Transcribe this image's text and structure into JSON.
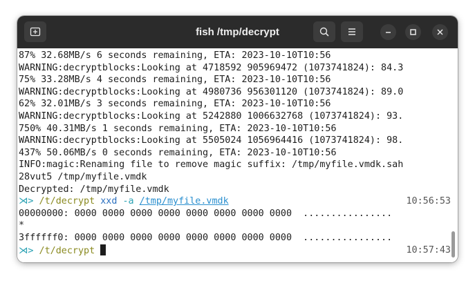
{
  "window": {
    "title": "fish /tmp/decrypt"
  },
  "titlebar": {
    "new_tab_icon": "new-tab-icon",
    "search_icon": "search-icon",
    "menu_icon": "hamburger-menu-icon",
    "minimize_icon": "minimize-icon",
    "maximize_icon": "maximize-icon",
    "close_icon": "close-icon"
  },
  "terminal": {
    "output": [
      "87% 32.68MB/s 6 seconds remaining, ETA: 2023-10-10T10:56",
      "WARNING:decryptblocks:Looking at 4718592 905969472 (1073741824): 84.3",
      "75% 33.28MB/s 4 seconds remaining, ETA: 2023-10-10T10:56",
      "WARNING:decryptblocks:Looking at 4980736 956301120 (1073741824): 89.0",
      "62% 32.01MB/s 3 seconds remaining, ETA: 2023-10-10T10:56",
      "WARNING:decryptblocks:Looking at 5242880 1006632768 (1073741824): 93.",
      "750% 40.31MB/s 1 seconds remaining, ETA: 2023-10-10T10:56",
      "WARNING:decryptblocks:Looking at 5505024 1056964416 (1073741824): 98.",
      "437% 50.06MB/s 0 seconds remaining, ETA: 2023-10-10T10:56",
      "INFO:magic:Renaming file to remove magic suffix: /tmp/myfile.vmdk.sah",
      "28vut5 /tmp/myfile.vmdk",
      "Decrypted: /tmp/myfile.vmdk"
    ],
    "prompt1": {
      "arrow": "⋊>",
      "dir": "/t/decrypt",
      "command": "xxd",
      "flag": "-a",
      "path": "/tmp/myfile.vmdk",
      "time": "10:56:53"
    },
    "hexdump": [
      "00000000: 0000 0000 0000 0000 0000 0000 0000 0000  ................",
      "*",
      "3ffffff0: 0000 0000 0000 0000 0000 0000 0000 0000  ................"
    ],
    "prompt2": {
      "arrow": "⋊>",
      "dir": "/t/decrypt",
      "time": "10:57:43"
    }
  },
  "colors": {
    "titlebar_bg": "#2b2b2b",
    "terminal_bg": "#ffffff",
    "prompt_arrow": "#2aa1b3",
    "prompt_dir": "#8a8a20",
    "command": "#2a6fbf"
  }
}
